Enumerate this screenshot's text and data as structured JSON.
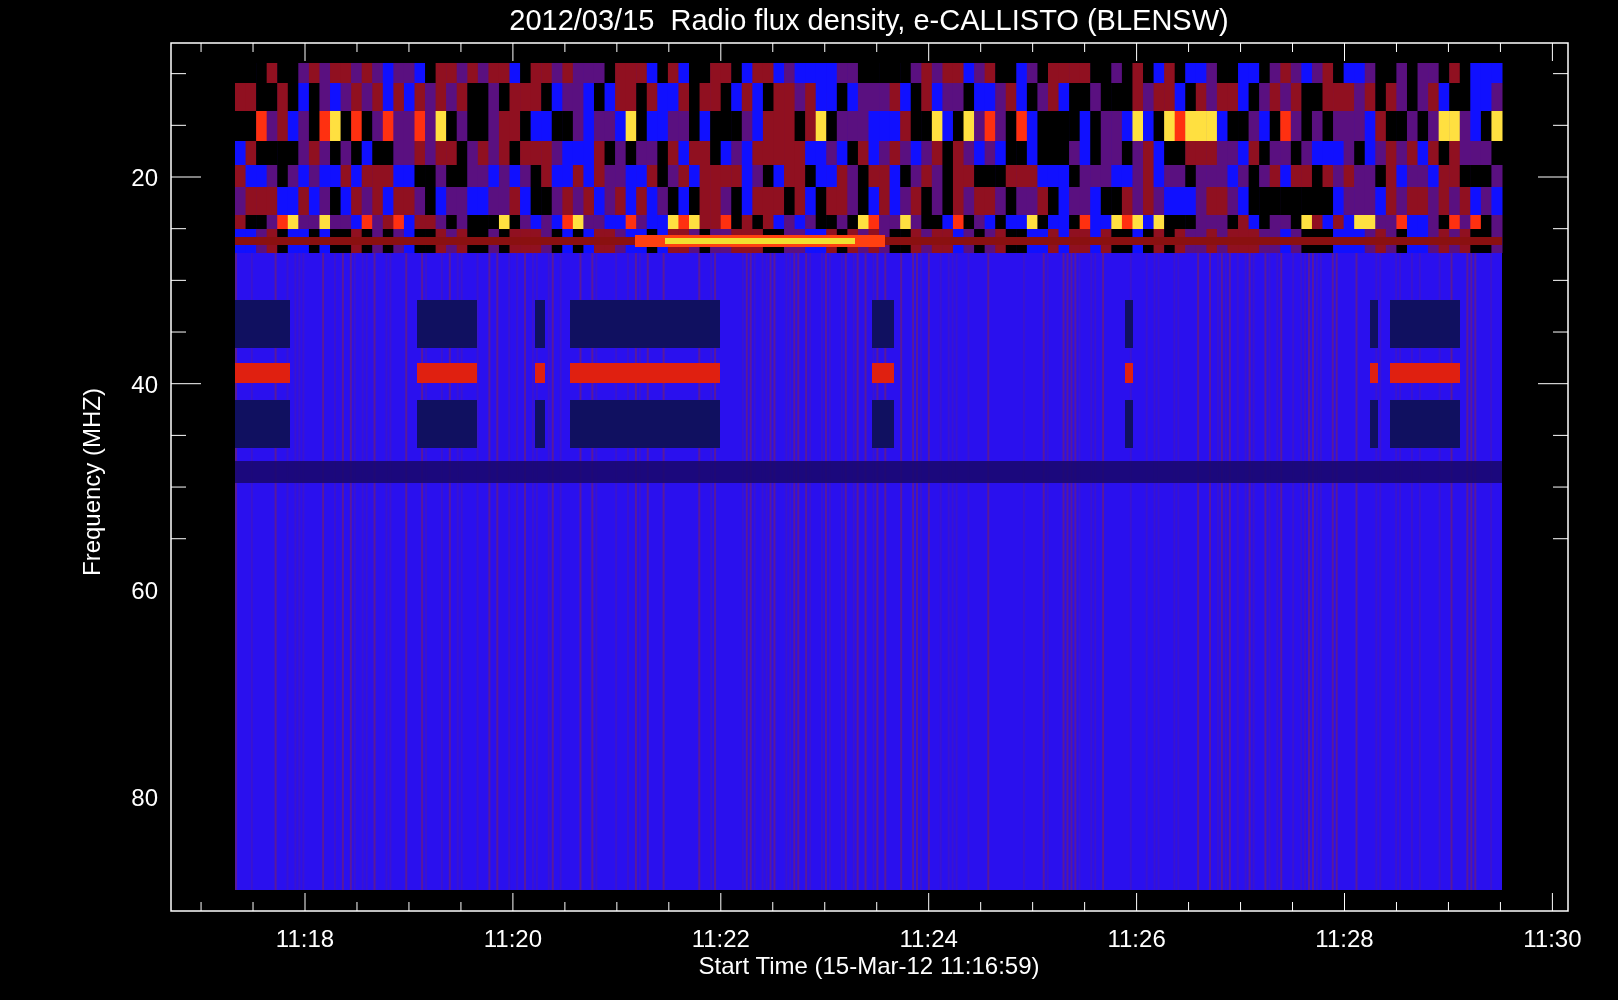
{
  "title": "2012/03/15  Radio flux density, e-CALLISTO (BLENSW)",
  "x_axis": {
    "label": "Start Time (15-Mar-12 11:16:59)",
    "ticks": [
      "11:18",
      "11:20",
      "11:22",
      "11:24",
      "11:26",
      "11:28",
      "11:30"
    ]
  },
  "y_axis": {
    "label": "Frequency (MHZ)",
    "ticks": [
      "20",
      "40",
      "60",
      "80"
    ]
  }
}
